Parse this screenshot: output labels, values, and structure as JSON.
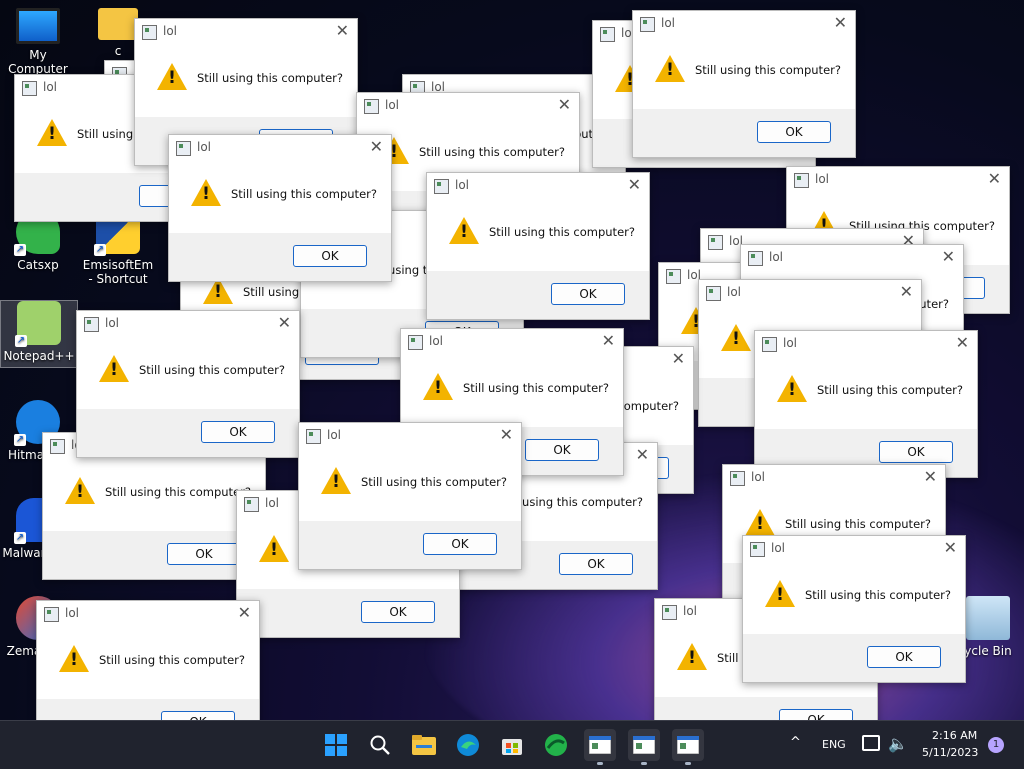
{
  "dialog": {
    "title": "lol",
    "message": "Still using this computer?",
    "message_partial_left": "Still u",
    "message_partial_right": "this computer?",
    "ok_label": "OK",
    "close_glyph": "✕"
  },
  "desktop_icons": [
    {
      "label": "My Computer",
      "icon": "monitor-icon"
    },
    {
      "label": "c",
      "icon": "folder-icon"
    },
    {
      "label": "Catsxp",
      "icon": "catsxp-icon"
    },
    {
      "label": "EmsisoftEm - Shortcut",
      "icon": "emsisoft-icon"
    },
    {
      "label": "Notepad++",
      "icon": "notepad-plus-plus-icon"
    },
    {
      "label": "Hitma",
      "icon": "hitmanpro-icon"
    },
    {
      "label": "Malwar",
      "icon": "malwarebytes-icon"
    },
    {
      "label": "Zema",
      "icon": "zemana-icon"
    },
    {
      "label": "ycle Bin",
      "icon": "recycle-bin-icon"
    }
  ],
  "taskbar": {
    "apps": [
      "windows-start-icon",
      "search-icon",
      "file-explorer-icon",
      "edge-icon",
      "microsoft-store-icon",
      "catsxp-browser-icon",
      "dialog-app-icon",
      "dialog-app-icon",
      "dialog-app-icon"
    ],
    "tray": {
      "chevron": "^",
      "language": "ENG",
      "time": "2:16 AM",
      "date": "5/11/2023",
      "notification_count": "1"
    }
  },
  "colors": {
    "accent": "#1a66c8",
    "warning": "#f3b300",
    "taskbar": "#20232e"
  }
}
